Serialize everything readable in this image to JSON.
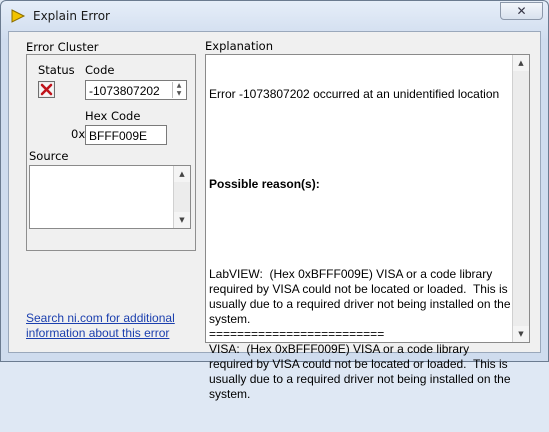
{
  "window": {
    "title": "Explain Error",
    "close_symbol": "✕"
  },
  "error_cluster": {
    "label": "Error Cluster",
    "status_label": "Status",
    "code_label": "Code",
    "code_value": "-1073807202",
    "hex_label": "Hex Code",
    "hex_prefix": "0x",
    "hex_value": "BFFF009E",
    "source_label": "Source",
    "source_value": ""
  },
  "explanation": {
    "label": "Explanation",
    "line1": "Error -1073807202 occurred at an unidentified location",
    "heading": "Possible reason(s):",
    "body": "LabVIEW:  (Hex 0xBFFF009E) VISA or a code library required by VISA could not be located or loaded.  This is usually due to a required driver not being installed on the system.\n=========================\nVISA:  (Hex 0xBFFF009E) VISA or a code library required by VISA could not be located or loaded.  This is usually due to a required driver not being installed on the system."
  },
  "help_link": {
    "line1": "Search ni.com for additional",
    "line2": "information about this error"
  },
  "colors": {
    "link": "#1b3fae",
    "status_error": "#c0141c"
  }
}
